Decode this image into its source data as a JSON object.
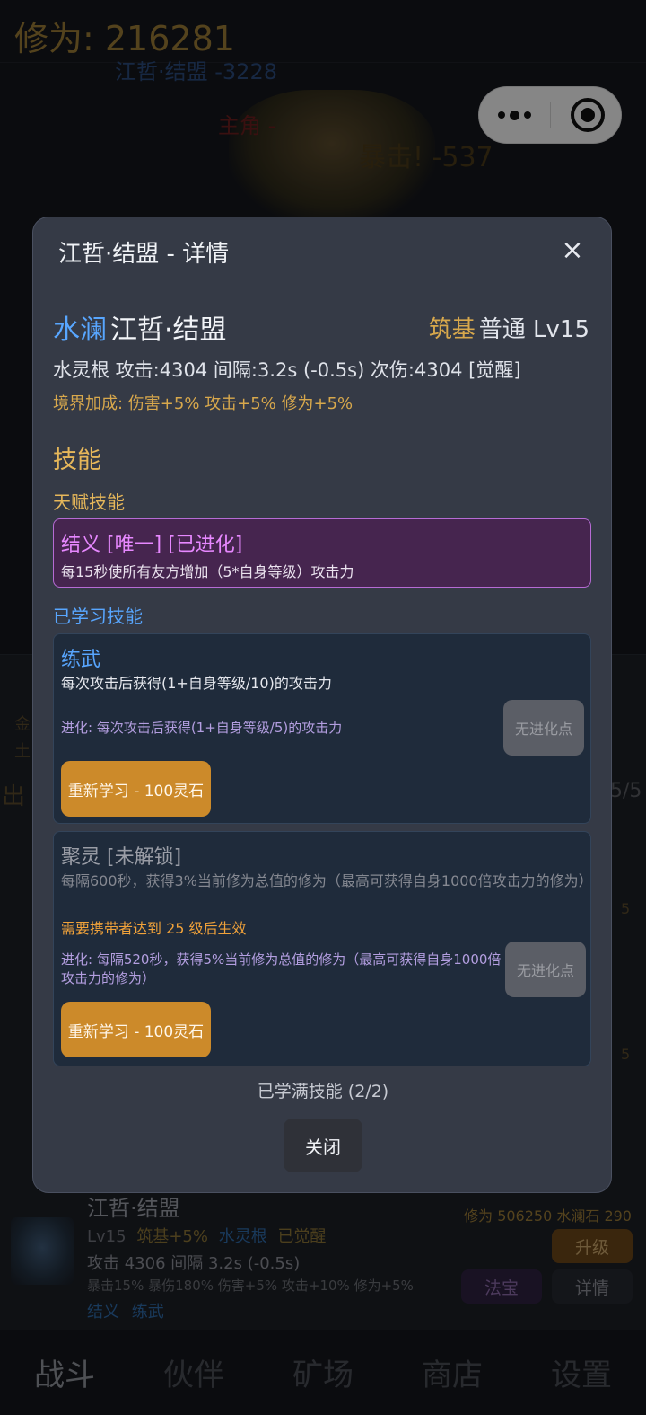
{
  "background": {
    "xiuwei": "修为: 216281",
    "floats": [
      "江哲·结盟 -3228",
      "主角 -",
      "暴击! -537"
    ],
    "partner_card": {
      "name": "江哲·结盟",
      "line1": {
        "level": "Lv15",
        "realm": "筑基+5%",
        "root": "水灵根",
        "awaken": "已觉醒"
      },
      "line2": "攻击 4306  间隔 3.2s (-0.5s)",
      "line3": "暴击15% 暴伤180% 伤害+5% 攻击+10% 修为+5%",
      "line4": {
        "s1": "结义",
        "s2": "练武"
      },
      "resources": "修为 506250  水澜石 290",
      "btn_upgrade": "升级",
      "btn_treasure": "法宝",
      "btn_detail": "详情"
    },
    "side_fragments": [
      "出",
      "5/5",
      "金",
      "土",
      "5",
      "5"
    ]
  },
  "nav": [
    "战斗",
    "伙伴",
    "矿场",
    "商店",
    "设置"
  ],
  "modal": {
    "title": "江哲·结盟 - 详情",
    "close_icon": "×",
    "element": "水澜",
    "name": "江哲·结盟",
    "realm": "筑基",
    "grade_level": "普通 Lv15",
    "stats": "水灵根  攻击:4304  间隔:3.2s (-0.5s)  次伤:4304 [觉醒]",
    "bonus": "境界加成: 伤害+5%  攻击+5%  修为+5%",
    "skills_title": "技能",
    "talent_title": "天赋技能",
    "talent": {
      "name": "结义 [唯一] [已进化]",
      "desc": "每15秒使所有友方增加（5*自身等级）攻击力"
    },
    "learned_title": "已学习技能",
    "skills": [
      {
        "name": "练武",
        "desc": "每次攻击后获得(1+自身等级/10)的攻击力",
        "evolve": "进化: 每次攻击后获得(1+自身等级/5)的攻击力",
        "evo_btn": "无进化点",
        "relearn": "重新学习 - 100灵石"
      },
      {
        "name": "聚灵 [未解锁]",
        "desc": "每隔600秒，获得3%当前修为总值的修为（最高可获得自身1000倍攻击力的修为）",
        "requirement": "需要携带者达到 25 级后生效",
        "evolve": "进化: 每隔520秒，获得5%当前修为总值的修为（最高可获得自身1000倍攻击力的修为）",
        "evo_btn": "无进化点",
        "relearn": "重新学习 - 100灵石"
      }
    ],
    "learned_full": "已学满技能 (2/2)",
    "close_btn": "关闭"
  }
}
